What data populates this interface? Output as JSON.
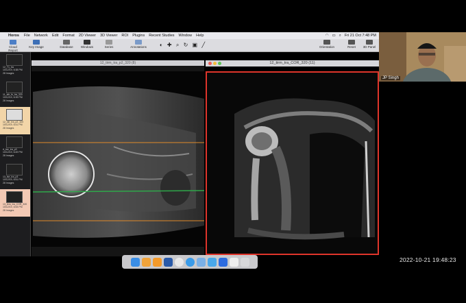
{
  "menubar": {
    "app_name": "Horos",
    "items": [
      "File",
      "Network",
      "Edit",
      "Format",
      "2D Viewer",
      "3D Viewer",
      "ROI",
      "Plugins",
      "Recent Studies",
      "Window",
      "Help"
    ],
    "clock": "Fri 21 Oct  7:48 PM"
  },
  "toolbar": {
    "cloud_report": "Cloud Report",
    "key_image": "Key Image",
    "database": "Database",
    "windows": "Windows",
    "series": "Series",
    "annotations": "Annotations",
    "orientation": "Orientation",
    "reset": "Reset",
    "three_d_panel": "3D Panel"
  },
  "thumbnails": [
    {
      "label": "12_T1_tra",
      "date": "10/12/19, 6:38 PM",
      "count": "28 Images"
    },
    {
      "label": "11_stir_fs_tra_320",
      "date": "10/12/19, 6:39 PM",
      "count": "28 Images"
    },
    {
      "label": "12_stir_tra_p2_320",
      "date": "10/12/19, 6:41 PM",
      "count": "28 Images"
    },
    {
      "label": "rt_tse_tra_p3",
      "date": "10/12/19, 6:49 PM",
      "count": "28 Images"
    },
    {
      "label": "13_tse_tra_p3",
      "date": "10/12/19, 6:51 PM",
      "count": "28 Images"
    },
    {
      "label": "13_tirm_tra_COR_320",
      "date": "10/12/19, 6:53 PM",
      "count": "28 Images"
    }
  ],
  "viewer_left": {
    "title": "12_tirm_tra_p2_320 (8)"
  },
  "viewer_right": {
    "title": "12_tirm_tra_COR_320 (11)"
  },
  "dock": {
    "icons": [
      "finder-icon",
      "photos-icon",
      "pages-icon",
      "word-icon",
      "chrome-icon",
      "safari-icon",
      "horos-icon",
      "mail-icon",
      "zoom-icon",
      "preview-icon",
      "trash-icon"
    ]
  },
  "participant": {
    "name": "JP Singh"
  },
  "timestamp": "2022-10-21  19:48:23",
  "colors": {
    "selection_border": "#e0352b",
    "crosshair_orange": "#e08a2a",
    "crosshair_green": "#2fa84a"
  }
}
